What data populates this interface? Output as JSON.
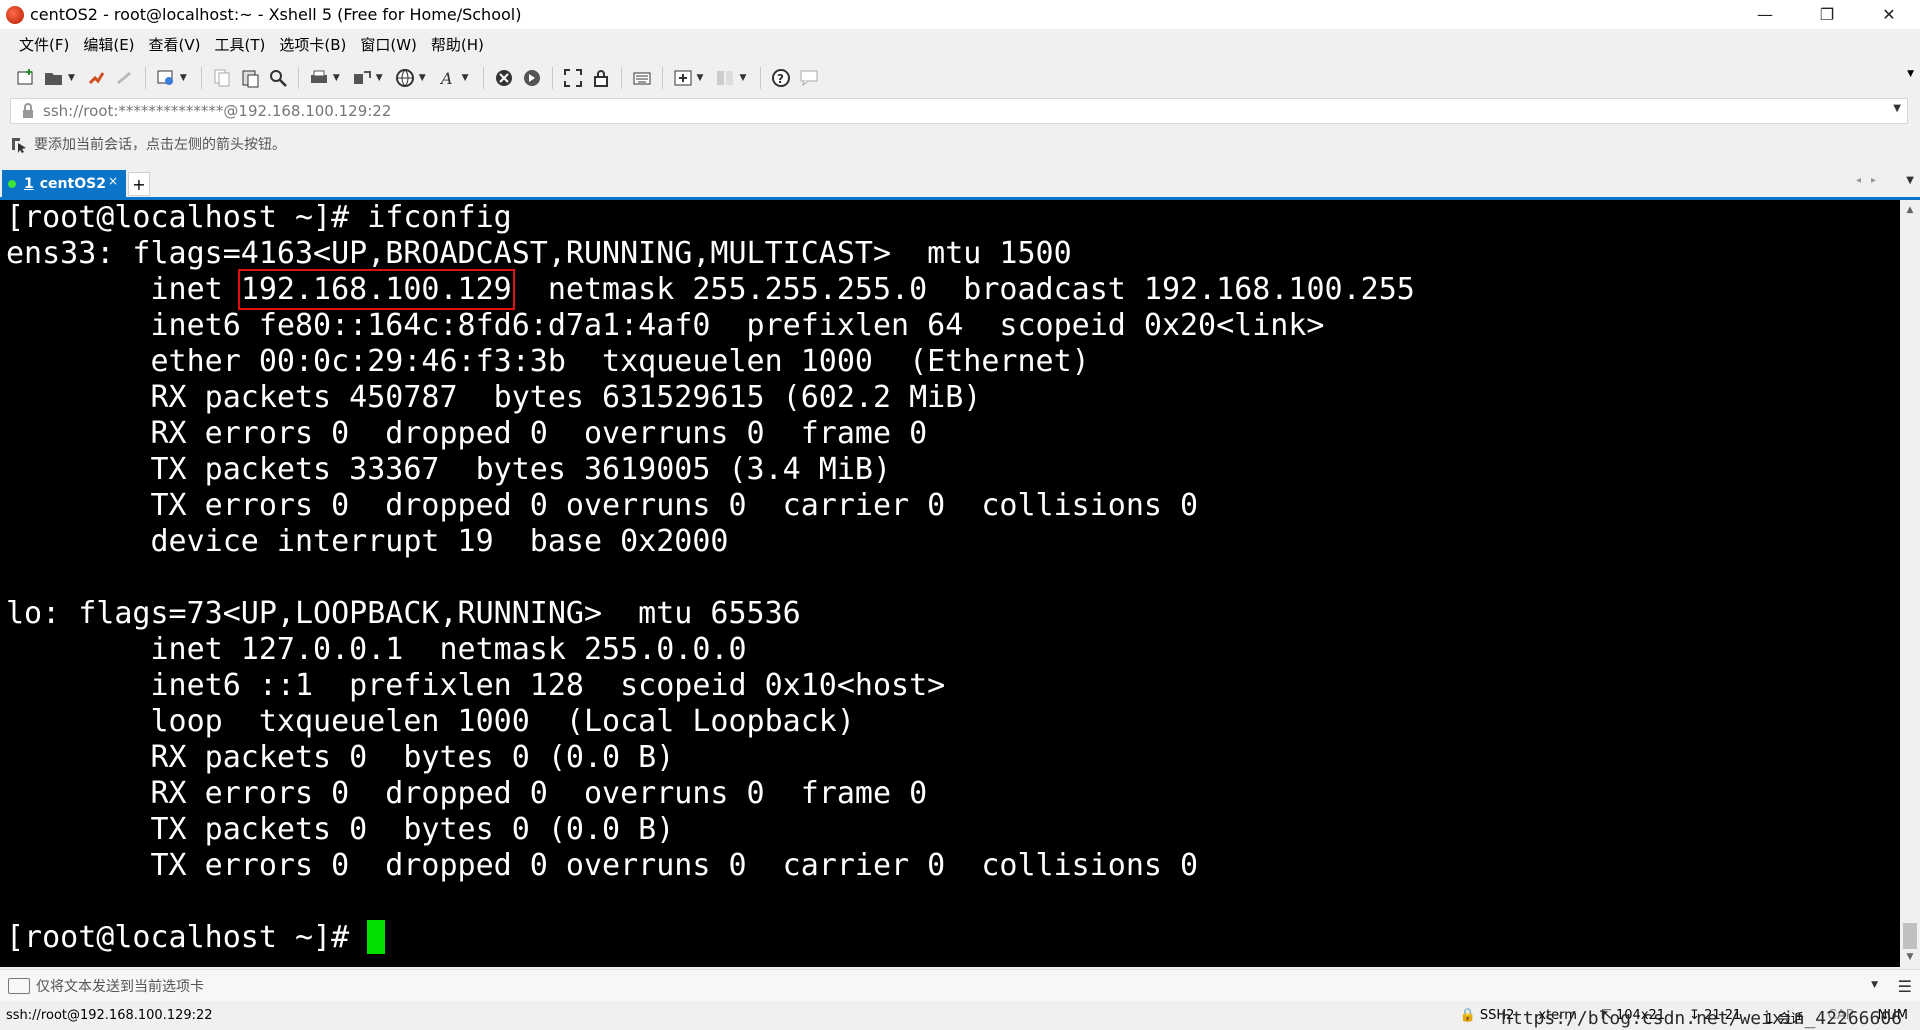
{
  "window": {
    "title": "centOS2 - root@localhost:~ - Xshell 5 (Free for Home/School)",
    "minimize": "—",
    "restore": "❐",
    "close": "✕"
  },
  "menu": [
    "文件(F)",
    "编辑(E)",
    "查看(V)",
    "工具(T)",
    "选项卡(B)",
    "窗口(W)",
    "帮助(H)"
  ],
  "address": {
    "value": "ssh://root:**************@192.168.100.129:22"
  },
  "hint": {
    "text": "要添加当前会话，点击左侧的箭头按钮。"
  },
  "tabs": [
    {
      "number": "1",
      "label": "centOS2",
      "close": "×"
    }
  ],
  "terminal": {
    "lines": [
      "[root@localhost ~]# ifconfig",
      "ens33: flags=4163<UP,BROADCAST,RUNNING,MULTICAST>  mtu 1500",
      "        inet ",
      "        inet6 fe80::164c:8fd6:d7a1:4af0  prefixlen 64  scopeid 0x20<link>",
      "        ether 00:0c:29:46:f3:3b  txqueuelen 1000  (Ethernet)",
      "        RX packets 450787  bytes 631529615 (602.2 MiB)",
      "        RX errors 0  dropped 0  overruns 0  frame 0",
      "        TX packets 33367  bytes 3619005 (3.4 MiB)",
      "        TX errors 0  dropped 0 overruns 0  carrier 0  collisions 0",
      "        device interrupt 19  base 0x2000",
      "",
      "lo: flags=73<UP,LOOPBACK,RUNNING>  mtu 65536",
      "        inet 127.0.0.1  netmask 255.0.0.0",
      "        inet6 ::1  prefixlen 128  scopeid 0x10<host>",
      "        loop  txqueuelen 1000  (Local Loopback)",
      "        RX packets 0  bytes 0 (0.0 B)",
      "        RX errors 0  dropped 0  overruns 0  frame 0",
      "        TX packets 0  bytes 0 (0.0 B)",
      "        TX errors 0  dropped 0 overruns 0  carrier 0  collisions 0",
      "",
      "[root@localhost ~]# "
    ],
    "highlighted_ip": "192.168.100.129",
    "inet_rest": "  netmask 255.255.255.0  broadcast 192.168.100.255",
    "watermark": "https://blog.csdn.net/weixin_42266606",
    "highlight_color": "#e01010",
    "cursor_color": "#00e000"
  },
  "compose": {
    "text": "仅将文本发送到当前选项卡"
  },
  "status": {
    "connection": "ssh://root@192.168.100.129:22",
    "protocol": "SSH2",
    "terminal_type": "xterm",
    "size": "104x21",
    "cursor_pos": "21,21",
    "sessions": "1 会话",
    "cap": "CAP",
    "num": "NUM"
  },
  "colors": {
    "accent": "#0a74c9",
    "terminal_bg": "#000000",
    "terminal_fg": "#ffffff"
  },
  "toolbar_icons": [
    "new-session-icon",
    "open-folder-icon",
    "reconnect-icon",
    "disconnect-icon",
    "properties-icon",
    "copy-icon",
    "paste-icon",
    "find-icon",
    "print-icon",
    "transfer-icon",
    "globe-icon",
    "font-icon",
    "xftp-icon",
    "script-icon",
    "fullscreen-icon",
    "lock-icon",
    "keyboard-icon",
    "new-tab-icon",
    "layout-icon",
    "help-icon",
    "chat-icon"
  ]
}
